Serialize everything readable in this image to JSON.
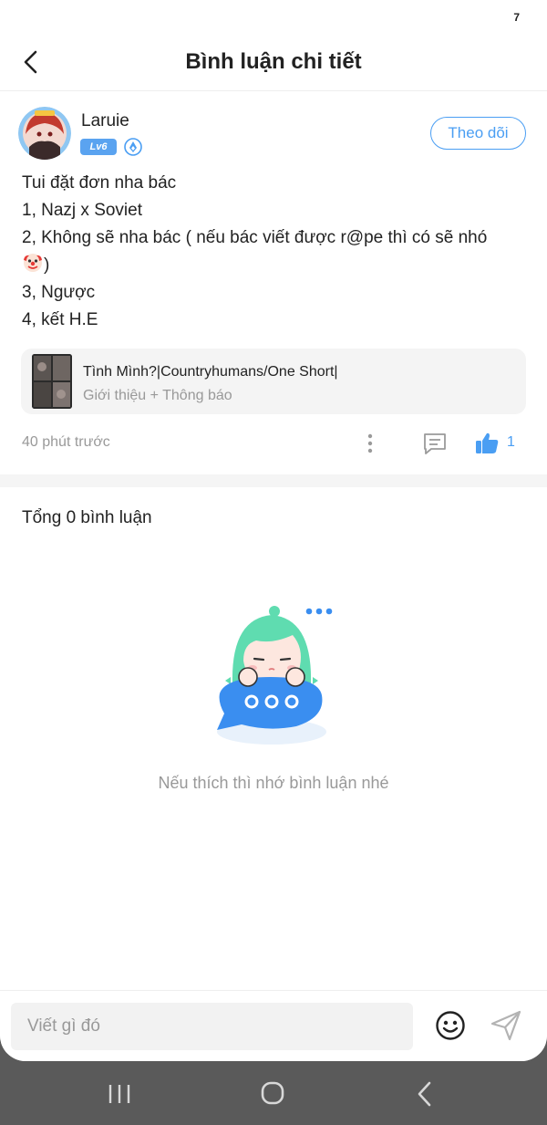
{
  "status_bar": {
    "glyph": "7"
  },
  "header": {
    "title": "Bình luận chi tiết",
    "back_icon": "chevron-left-icon"
  },
  "post": {
    "username": "Laruie",
    "level_badge": "Lv6",
    "follow_label": "Theo dõi",
    "body_lines": [
      "Tui đặt đơn nha bác",
      "1, Nazj x Soviet",
      "2, Không sẽ nha bác ( nếu bác viết được r@pe thì có sẽ nhó",
      ")",
      "3, Ngược",
      "4, kết H.E"
    ],
    "emoji": "clown-face",
    "story": {
      "title": "Tình Mình?|Countryhumans/One Short|",
      "subtitle": "Giới thiệu + Thông báo"
    },
    "time_ago": "40 phút trước",
    "like_count": "1"
  },
  "comments": {
    "total_label": "Tổng 0 bình luận",
    "empty_text": "Nếu thích thì nhớ bình luận nhé"
  },
  "input": {
    "placeholder": "Viết gì đó"
  },
  "colors": {
    "accent": "#4a9ef3",
    "muted": "#999999",
    "text": "#222222",
    "mascot_hair": "#5fdcb0",
    "bubble": "#3a8ef0"
  }
}
